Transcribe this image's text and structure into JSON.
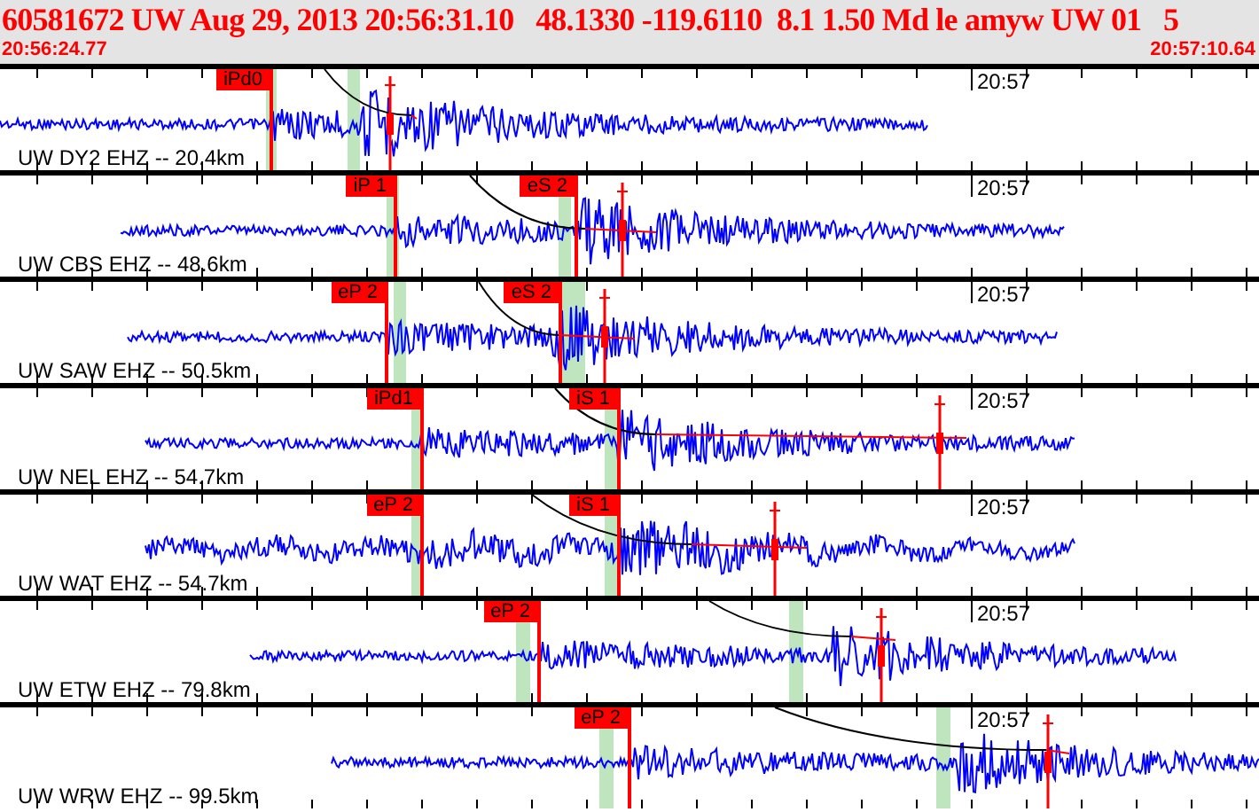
{
  "header": {
    "title": "60581672 UW Aug 29, 2013 20:56:31.10   48.1330 -119.6110  8.1 1.50 Md le amyw UW 01   5",
    "start_time": "20:56:24.77",
    "end_time": "20:57:10.64"
  },
  "traces": [
    {
      "label": "UW DY2 EHZ -- 20.4km",
      "time_mark": "20:57",
      "picks": [
        {
          "label": "iPd0"
        }
      ]
    },
    {
      "label": "UW CBS EHZ -- 48.6km",
      "time_mark": "20:57",
      "picks": [
        {
          "label": "iP 1"
        },
        {
          "label": "eS 2"
        }
      ]
    },
    {
      "label": "UW SAW EHZ -- 50.5km",
      "time_mark": "20:57",
      "picks": [
        {
          "label": "eP 2"
        },
        {
          "label": "eS 2"
        }
      ]
    },
    {
      "label": "UW NEL EHZ -- 54.7km",
      "time_mark": "20:57",
      "picks": [
        {
          "label": "iPd1"
        },
        {
          "label": "iS 1"
        }
      ]
    },
    {
      "label": "UW WAT EHZ -- 54.7km",
      "time_mark": "20:57",
      "picks": [
        {
          "label": "eP 2"
        },
        {
          "label": "iS 1"
        }
      ]
    },
    {
      "label": "UW ETW EHZ -- 79.8km",
      "time_mark": "20:57",
      "picks": [
        {
          "label": "eP 2"
        }
      ]
    },
    {
      "label": "UW WRW EHZ -- 99.5km",
      "time_mark": "20:57",
      "picks": [
        {
          "label": "eP 2"
        }
      ]
    }
  ]
}
